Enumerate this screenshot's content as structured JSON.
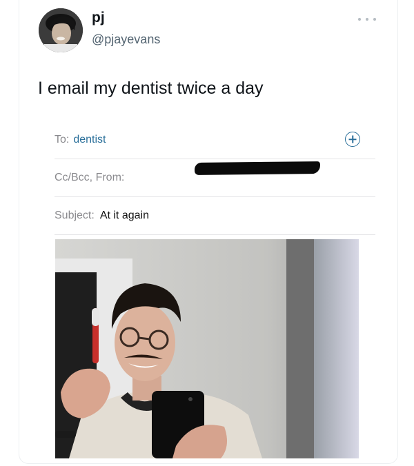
{
  "author": {
    "name": "pj",
    "handle": "@pjayevans"
  },
  "tweet": {
    "text": "I email my dentist twice a day"
  },
  "email": {
    "to_label": "To:",
    "to_value": "dentist",
    "cc_label": "Cc/Bcc, From:",
    "subject_label": "Subject:",
    "subject_value": "At it again"
  },
  "icons": {
    "add_recipient": "plus-circle-icon",
    "more": "more-options-icon"
  },
  "colors": {
    "link_blue": "#2a6f9a",
    "muted_text": "#8a8a8e",
    "handle_gray": "#536471"
  }
}
